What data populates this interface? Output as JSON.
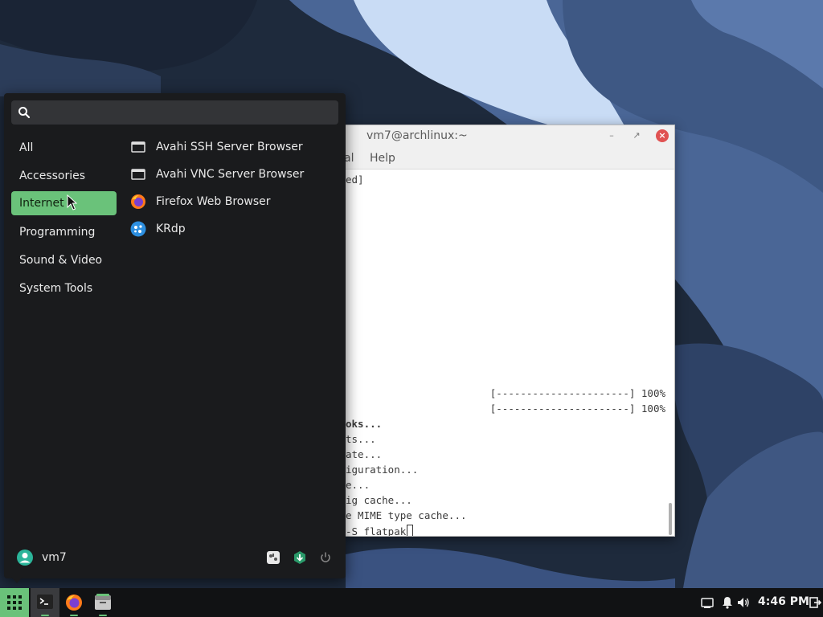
{
  "terminal": {
    "title": "vm7@archlinux:~",
    "menu": [
      "al",
      "Help"
    ],
    "lines": [
      {
        "text": "ed]",
        "style": "normal"
      },
      {
        "text": "[----------------------] 100%",
        "style": "right"
      },
      {
        "text": "[----------------------] 100%",
        "style": "right"
      },
      {
        "text": "oks...",
        "style": "bold"
      },
      {
        "text": "ts...",
        "style": "normal"
      },
      {
        "text": "ate...",
        "style": "normal"
      },
      {
        "text": "iguration...",
        "style": "normal"
      },
      {
        "text": "e...",
        "style": "normal"
      },
      {
        "text": "ig cache...",
        "style": "normal"
      },
      {
        "text": "e MIME type cache...",
        "style": "normal"
      },
      {
        "text": "-S flatpak",
        "style": "prompt"
      }
    ]
  },
  "menu": {
    "search_placeholder": "",
    "categories": [
      {
        "label": "All",
        "active": false
      },
      {
        "label": "Accessories",
        "active": false
      },
      {
        "label": "Internet",
        "active": true
      },
      {
        "label": "Programming",
        "active": false
      },
      {
        "label": "Sound & Video",
        "active": false
      },
      {
        "label": "System Tools",
        "active": false
      }
    ],
    "apps": [
      {
        "label": "Avahi SSH Server Browser",
        "icon": "network-icon"
      },
      {
        "label": "Avahi VNC Server Browser",
        "icon": "network-icon"
      },
      {
        "label": "Firefox Web Browser",
        "icon": "firefox-icon"
      },
      {
        "label": "KRdp",
        "icon": "krdp-icon"
      }
    ],
    "user": "vm7"
  },
  "taskbar": {
    "clock": "4:46 PM",
    "apps": [
      "terminal-icon",
      "firefox-icon",
      "files-icon"
    ]
  },
  "colors": {
    "accent": "#6ac27a",
    "menu_bg": "#1a1b1d",
    "desktop_dark": "#1e2a3c",
    "desktop_mid": "#4a6696",
    "desktop_light": "#c9dcf5"
  }
}
